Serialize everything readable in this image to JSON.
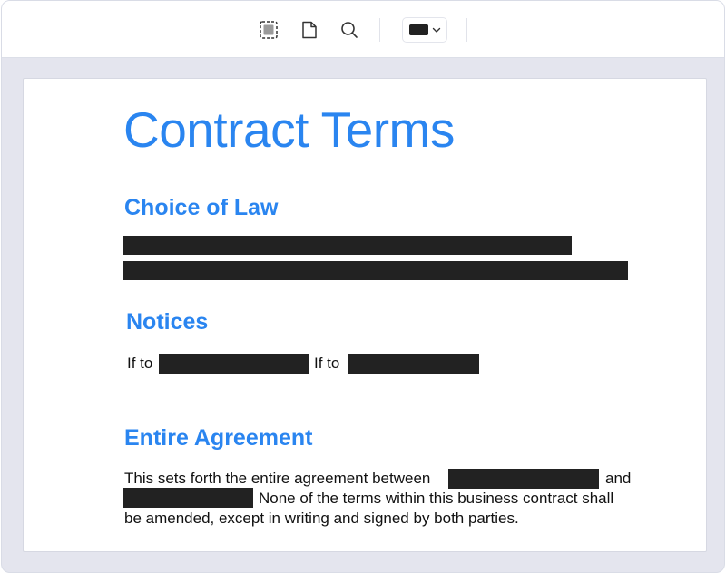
{
  "toolbar": {
    "tools": [
      {
        "name": "select-area",
        "icon": "dashed-select-icon"
      },
      {
        "name": "page",
        "icon": "document-icon"
      },
      {
        "name": "search",
        "icon": "search-icon"
      }
    ],
    "color_picker": {
      "selected_color": "#222222",
      "icon": "chevron-down-icon"
    }
  },
  "document": {
    "title": "Contract Terms",
    "sections": {
      "choice_of_law": {
        "heading": "Choice of Law"
      },
      "notices": {
        "heading": "Notices",
        "if_to_1": "If to",
        "if_to_2": "If to"
      },
      "entire_agreement": {
        "heading": "Entire Agreement",
        "line1_start": "This sets forth the entire agreement between",
        "line1_end": "and",
        "line2_end": "None of the terms within this business contract shall",
        "line3": "be amended, except in writing and signed by both parties."
      }
    }
  },
  "colors": {
    "accent": "#2a85f0",
    "redaction": "#222222",
    "backdrop": "#e4e5ee"
  }
}
